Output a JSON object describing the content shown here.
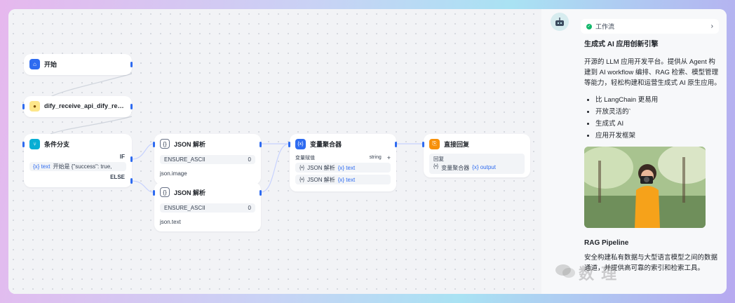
{
  "canvas": {
    "nodes": {
      "start": {
        "title": "开始"
      },
      "api": {
        "title": "dify_receive_api_dify_rec..."
      },
      "branch": {
        "title": "条件分支",
        "if_label": "IF",
        "condition_var": "{x} text",
        "condition_text": "开始是 {\"success\": true,",
        "else_label": "ELSE"
      },
      "json1": {
        "title": "JSON 解析",
        "param": "ENSURE_ASCII",
        "param_value": "0",
        "output": "json.image"
      },
      "json2": {
        "title": "JSON 解析",
        "param": "ENSURE_ASCII",
        "param_value": "0",
        "output": "json.text"
      },
      "aggregator": {
        "title": "变量聚合器",
        "label": "变量赋值",
        "type": "string",
        "add": "+",
        "rows": [
          {
            "source": "JSON 解析",
            "var": "{x} text"
          },
          {
            "source": "JSON 解析",
            "var": "{x} text"
          }
        ]
      },
      "reply": {
        "title": "直接回复",
        "label": "回复",
        "source": "变量聚合器",
        "var": "{x} output"
      }
    }
  },
  "sidebar": {
    "pill_label": "工作流",
    "pill_chevron": "›",
    "title": "生成式 AI 应用创新引擎",
    "paragraph": "开源的 LLM 应用开发平台。提供从 Agent 构建到 AI workflow 编排、RAG 检索、模型管理等能力，轻松构建和运营生成式 AI 原生应用。",
    "bullets": [
      "比 LangChain 更易用",
      "开放灵活的`",
      "生成式 AI",
      "应用开发框架"
    ],
    "section2_title": "RAG Pipeline",
    "section2_text": "安全构建私有数据与大型语言模型之间的数据通道，并提供高可靠的索引和检索工具。",
    "watermark": "数 理"
  },
  "colors": {
    "accent": "#2e6bf0",
    "start_icon": "#2e6bf0",
    "branch_icon": "#06aed4",
    "aggregator_icon": "#2e6bf0",
    "reply_icon": "#f79009",
    "success": "#12b76a"
  },
  "icons": {
    "start": "home-icon",
    "api": "tool-icon",
    "branch": "branch-icon",
    "json": "code-icon",
    "aggregator": "variable-icon",
    "reply": "reply-icon",
    "avatar": "bot-icon"
  }
}
